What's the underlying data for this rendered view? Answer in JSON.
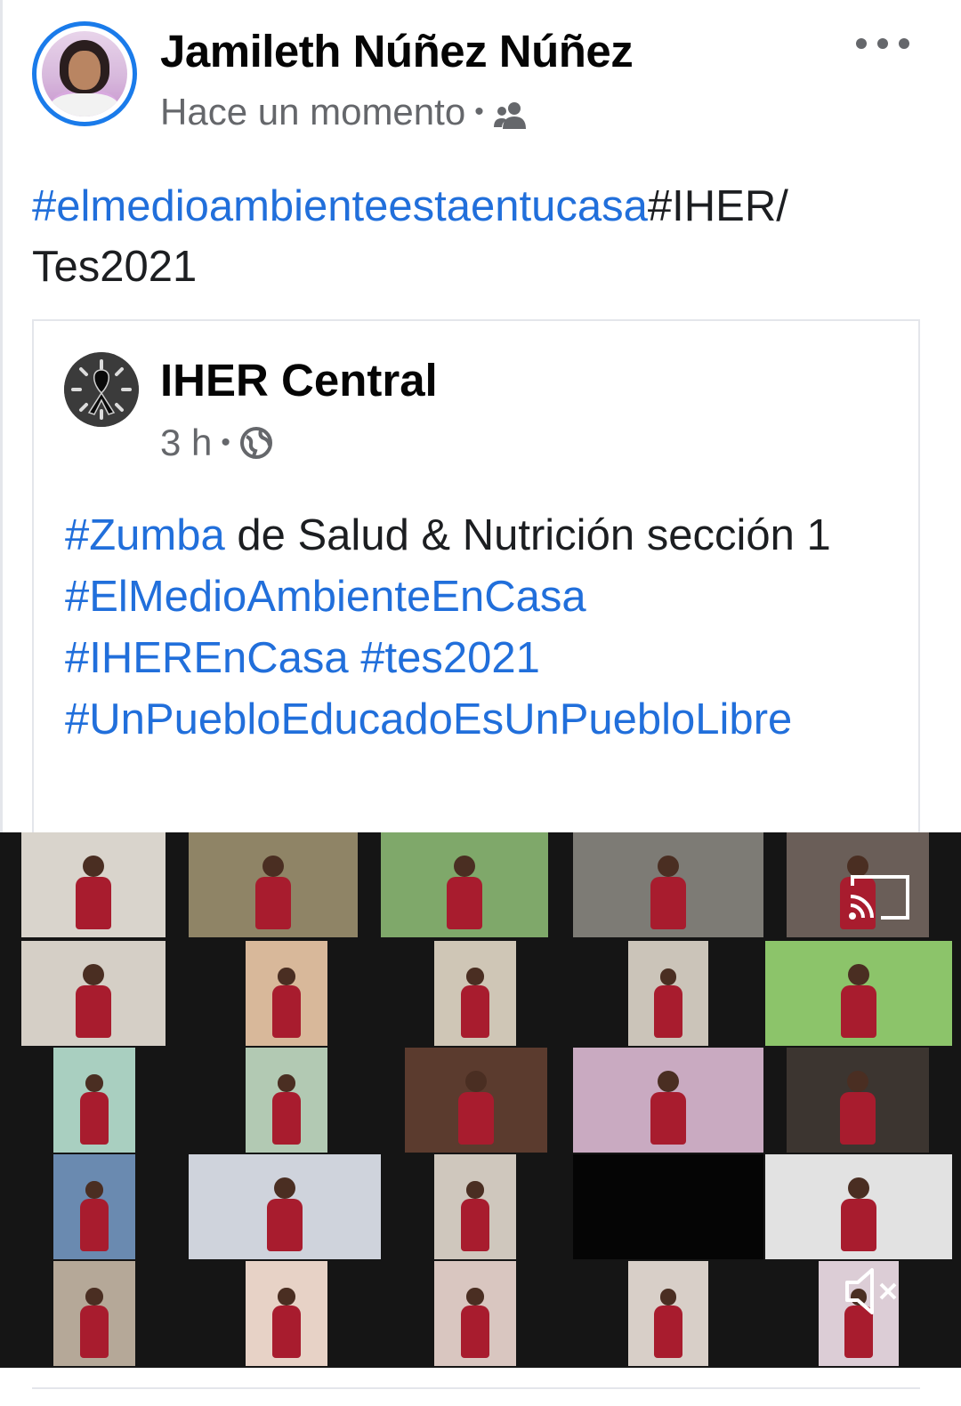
{
  "post": {
    "author": "Jamileth Núñez Núñez",
    "time": "Hace un momento",
    "separator": "•",
    "audience_icon": "friends-icon",
    "more_icon": "more-options-icon",
    "text": {
      "hashtag": "#elmedioambienteestaentucasa",
      "rest": "#IHER/ Tes2021"
    }
  },
  "shared": {
    "page_name": "IHER Central",
    "time": "3 h",
    "separator": "•",
    "audience_icon": "globe-icon",
    "line1_hashtag": "#Zumba",
    "line1_rest": " de Salud & Nutrición sección 1",
    "hashtags": [
      "#ElMedioAmbienteEnCasa",
      "#IHEREnCasa",
      "#tes2021",
      "#UnPuebloEducadoEsUnPuebloLibre"
    ]
  },
  "video": {
    "cast_icon": "cast-icon",
    "mute_icon": "muted-speaker-icon"
  },
  "colors": {
    "link": "#216fdb",
    "avatar_ring": "#1a7bea",
    "meta_text": "#65676b",
    "uniform": "#a81c2e"
  }
}
